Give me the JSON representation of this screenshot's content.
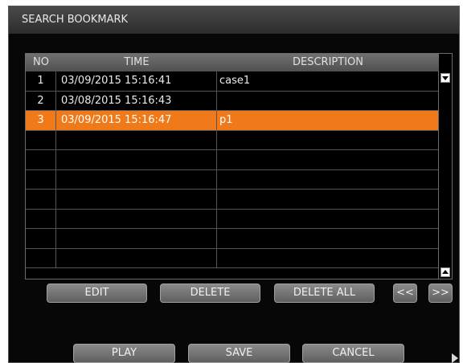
{
  "dialog": {
    "title": "SEARCH BOOKMARK"
  },
  "table": {
    "headers": {
      "no": "NO",
      "time": "TIME",
      "description": "DESCRIPTION"
    },
    "rows": [
      {
        "no": "1",
        "time": "03/09/2015  15:16:41",
        "description": "case1",
        "selected": false
      },
      {
        "no": "2",
        "time": "03/08/2015  15:16:43",
        "description": "",
        "selected": false
      },
      {
        "no": "3",
        "time": "03/09/2015  15:16:47",
        "description": "p1",
        "selected": true
      },
      {
        "no": "",
        "time": "",
        "description": "",
        "selected": false
      },
      {
        "no": "",
        "time": "",
        "description": "",
        "selected": false
      },
      {
        "no": "",
        "time": "",
        "description": "",
        "selected": false
      },
      {
        "no": "",
        "time": "",
        "description": "",
        "selected": false
      },
      {
        "no": "",
        "time": "",
        "description": "",
        "selected": false
      },
      {
        "no": "",
        "time": "",
        "description": "",
        "selected": false
      },
      {
        "no": "",
        "time": "",
        "description": "",
        "selected": false
      }
    ]
  },
  "actions": {
    "edit": "EDIT",
    "delete": "DELETE",
    "delete_all": "DELETE ALL",
    "prev": "<<",
    "next": ">>"
  },
  "footer": {
    "play": "PLAY",
    "save": "SAVE",
    "cancel": "CANCEL"
  },
  "colors": {
    "selected_row": "#f07a1a",
    "background": "#070707"
  }
}
